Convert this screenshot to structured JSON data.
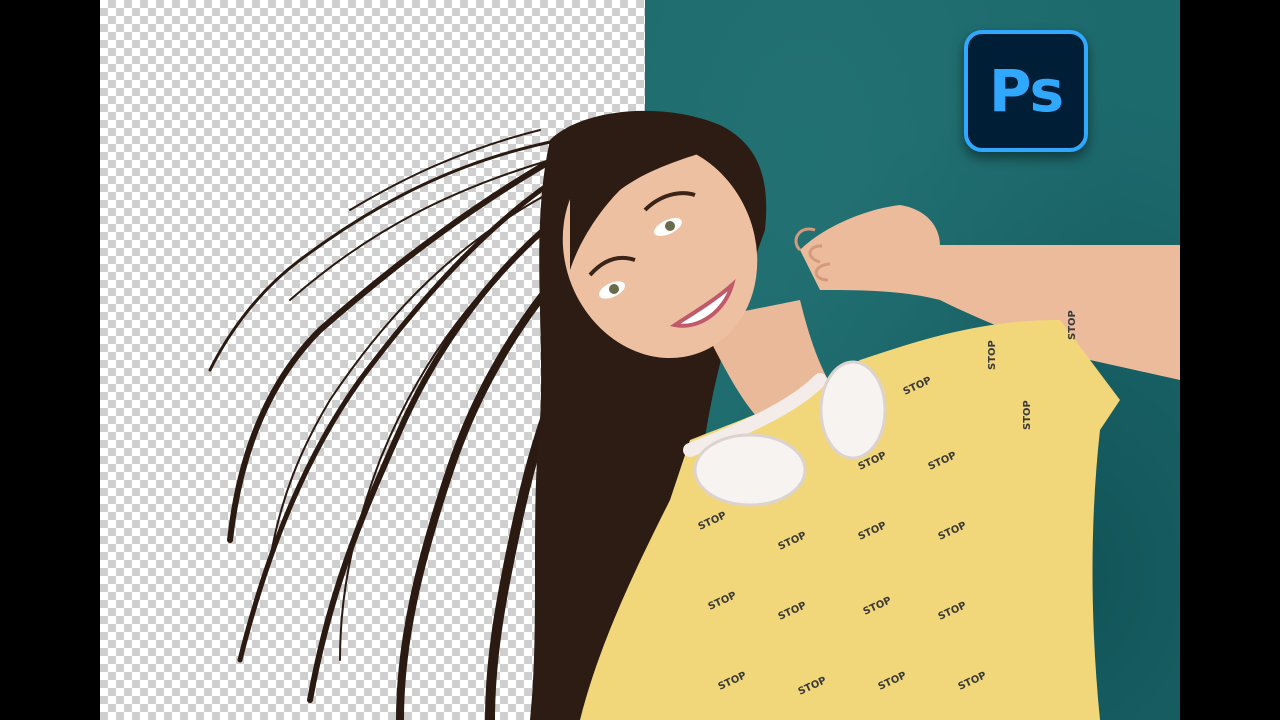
{
  "logo": {
    "text": "Ps",
    "icon": "photoshop-logo-icon",
    "bg_color": "#001e36",
    "accent_color": "#31a8ff"
  },
  "photo": {
    "shirt_print": [
      "STOP",
      "STOP",
      "STOP",
      "STOP",
      "STOP",
      "STOP",
      "STOP",
      "STOP",
      "STOP",
      "STOP",
      "STOP",
      "STOP",
      "STOP",
      "STOP",
      "STOP",
      "STOP",
      "STOP",
      "STOP"
    ]
  },
  "colors": {
    "teal_background": "#1d6a6d",
    "transparency_checker": "#cfcfcf",
    "shirt": "#f2d77a",
    "hair": "#2a1a12"
  }
}
